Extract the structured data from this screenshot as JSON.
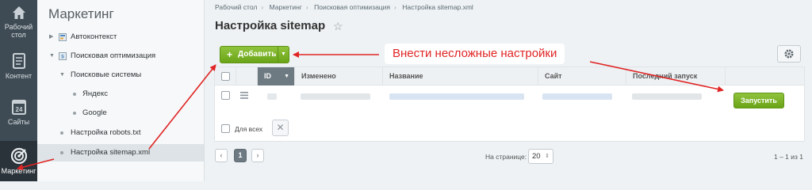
{
  "rail": {
    "items": [
      {
        "label_line1": "Рабочий",
        "label_line2": "стол",
        "icon": "home-icon"
      },
      {
        "label": "Контент",
        "icon": "document-icon"
      },
      {
        "label": "Сайты",
        "icon": "calendar-icon",
        "icon_text": "24"
      },
      {
        "label": "Маркетинг",
        "icon": "target-icon"
      }
    ]
  },
  "tree": {
    "title": "Маркетинг",
    "items": [
      {
        "label": "Автоконтекст"
      },
      {
        "label": "Поисковая оптимизация"
      },
      {
        "label": "Поисковые системы"
      },
      {
        "label": "Яндекс"
      },
      {
        "label": "Google"
      },
      {
        "label": "Настройка robots.txt"
      },
      {
        "label": "Настройка sitemap.xml"
      }
    ]
  },
  "breadcrumbs": [
    "Рабочий стол",
    "Маркетинг",
    "Поисковая оптимизация",
    "Настройка sitemap.xml"
  ],
  "page_title": "Настройка sitemap",
  "toolbar": {
    "add_label": "Добавить"
  },
  "annotation": {
    "text": "Внести несложные настройки",
    "color": "#e02424"
  },
  "grid": {
    "columns": [
      "ID",
      "Изменено",
      "Название",
      "Сайт",
      "Последний запуск"
    ],
    "run_label": "Запустить",
    "select_all_label": "Для всех"
  },
  "pager": {
    "current_page": "1",
    "per_page_label": "На странице:",
    "per_page_value": "20",
    "count_text": "1 – 1 из 1"
  },
  "colors": {
    "accent_green": "#7ab32e",
    "rail_bg": "#3f4b54",
    "arrow_red": "#e02424"
  }
}
